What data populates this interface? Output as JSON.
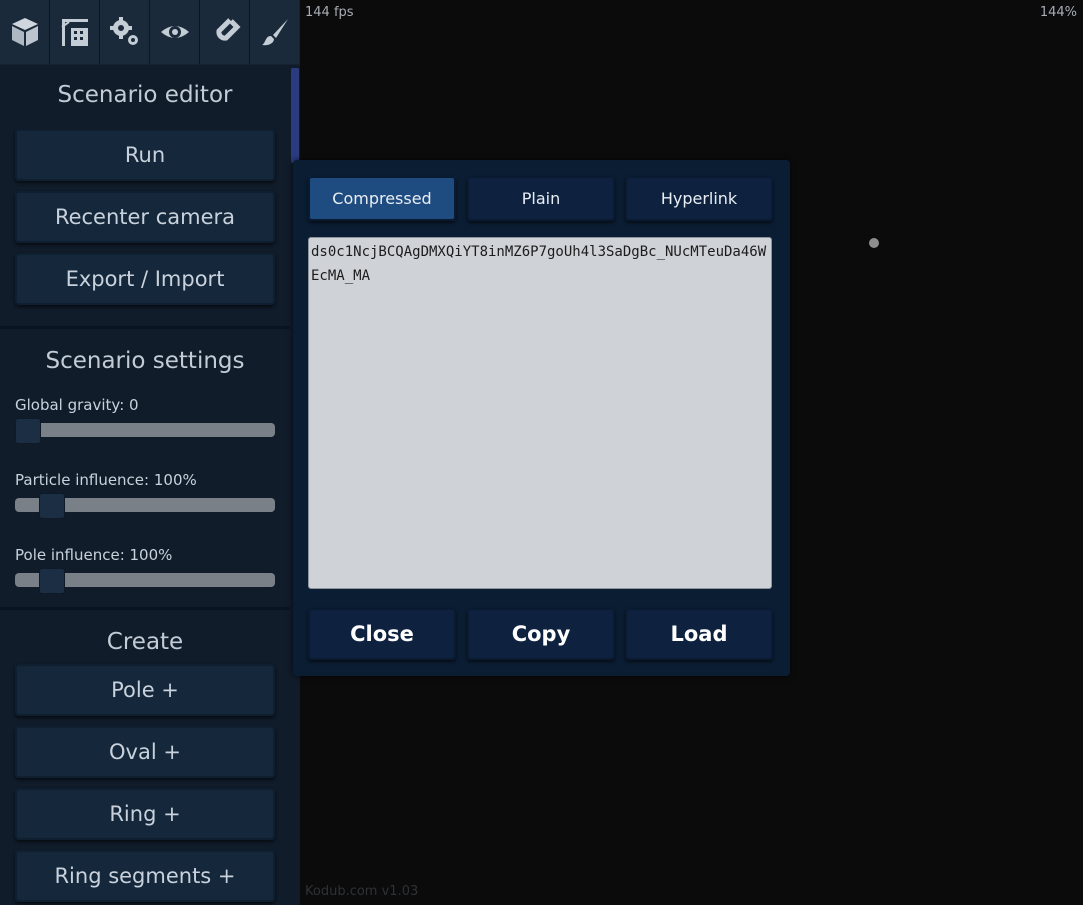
{
  "toolbar": {
    "icons": [
      "cube-icon",
      "crane-icon",
      "gears-icon",
      "eye-icon",
      "magnet-icon",
      "brush-icon"
    ]
  },
  "status": {
    "fps": "144 fps",
    "zoom": "144%",
    "version": "Kodub.com v1.03"
  },
  "sidebar": {
    "editor_title": "Scenario editor",
    "run_label": "Run",
    "recenter_label": "Recenter camera",
    "export_import_label": "Export / Import",
    "settings_title": "Scenario settings",
    "gravity_label": "Global gravity: 0",
    "gravity_value": 0,
    "particle_influence_label": "Particle influence: 100%",
    "particle_influence_value": 100,
    "pole_influence_label": "Pole influence: 100%",
    "pole_influence_value": 100,
    "create_title": "Create",
    "create_items": [
      "Pole +",
      "Oval +",
      "Ring +",
      "Ring segments +"
    ]
  },
  "dialog": {
    "tabs": [
      "Compressed",
      "Plain",
      "Hyperlink"
    ],
    "active_tab": "Compressed",
    "export_text": "ds0c1NcjBCQAgDMXQiYT8inMZ6P7goUh4l3SaDgBc_NUcMTeuDa46WEcMA_MA",
    "close_label": "Close",
    "copy_label": "Copy",
    "load_label": "Load"
  },
  "colors": {
    "sidebar_bg": "#101c2a",
    "button_bg": "#14273b",
    "dialog_bg": "#0b1d33",
    "active_tab": "#1f4c80",
    "canvas_bg": "#0b0b0b"
  }
}
